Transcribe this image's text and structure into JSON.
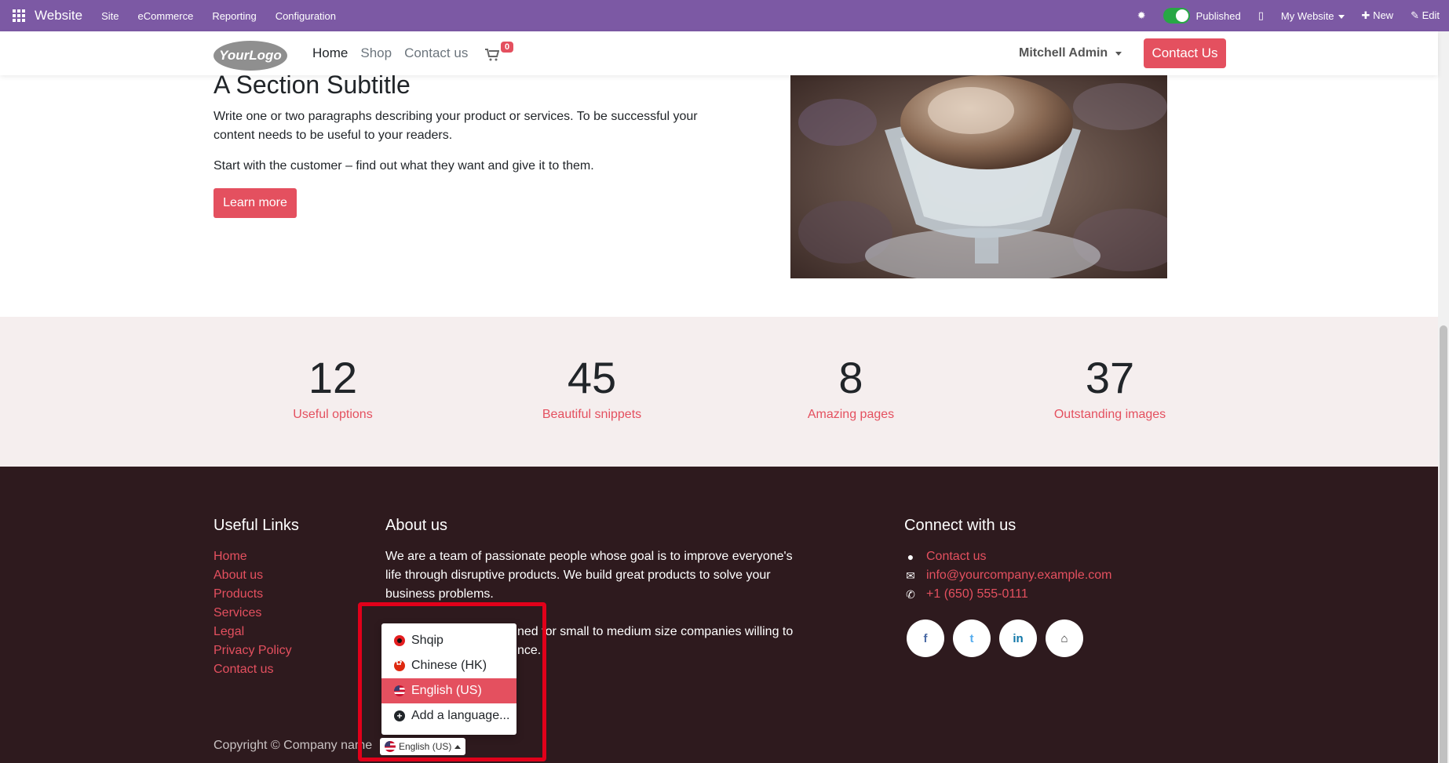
{
  "admin_bar": {
    "brand": "Website",
    "menus": [
      "Site",
      "eCommerce",
      "Reporting",
      "Configuration"
    ],
    "published_label": "Published",
    "site_selector": "My Website",
    "new_label": "New",
    "edit_label": "Edit"
  },
  "header": {
    "logo": "YourLogo",
    "nav": [
      "Home",
      "Shop",
      "Contact us"
    ],
    "cart_count": "0",
    "user": "Mitchell Admin",
    "contact_button": "Contact Us"
  },
  "hero": {
    "subtitle": "A Section Subtitle",
    "paragraph1": "Write one or two paragraphs describing your product or services. To be successful your content needs to be useful to your readers.",
    "paragraph2": "Start with the customer – find out what they want and give it to them.",
    "button": "Learn more"
  },
  "stats": [
    {
      "number": "12",
      "label": "Useful options"
    },
    {
      "number": "45",
      "label": "Beautiful snippets"
    },
    {
      "number": "8",
      "label": "Amazing pages"
    },
    {
      "number": "37",
      "label": "Outstanding images"
    }
  ],
  "footer": {
    "useful_links_title": "Useful Links",
    "useful_links": [
      "Home",
      "About us",
      "Products",
      "Services",
      "Legal",
      "Privacy Policy",
      "Contact us"
    ],
    "about_title": "About us",
    "about_text1": "We are a team of passionate people whose goal is to improve everyone's life through disruptive products. We build great products to solve your business problems.",
    "about_text2_visible": "ned for small to medium size companies willing to",
    "about_text2_line2": "nce.",
    "connect_title": "Connect with us",
    "contact_link": "Contact us",
    "email": "info@yourcompany.example.com",
    "phone": "+1 (650) 555-0111",
    "socials": [
      "f",
      "t",
      "in",
      "⌂"
    ],
    "copyright": "Copyright © Company name"
  },
  "language": {
    "current": "English (US)",
    "options": [
      "Shqip",
      "Chinese (HK)",
      "English (US)"
    ],
    "add": "Add a language..."
  }
}
